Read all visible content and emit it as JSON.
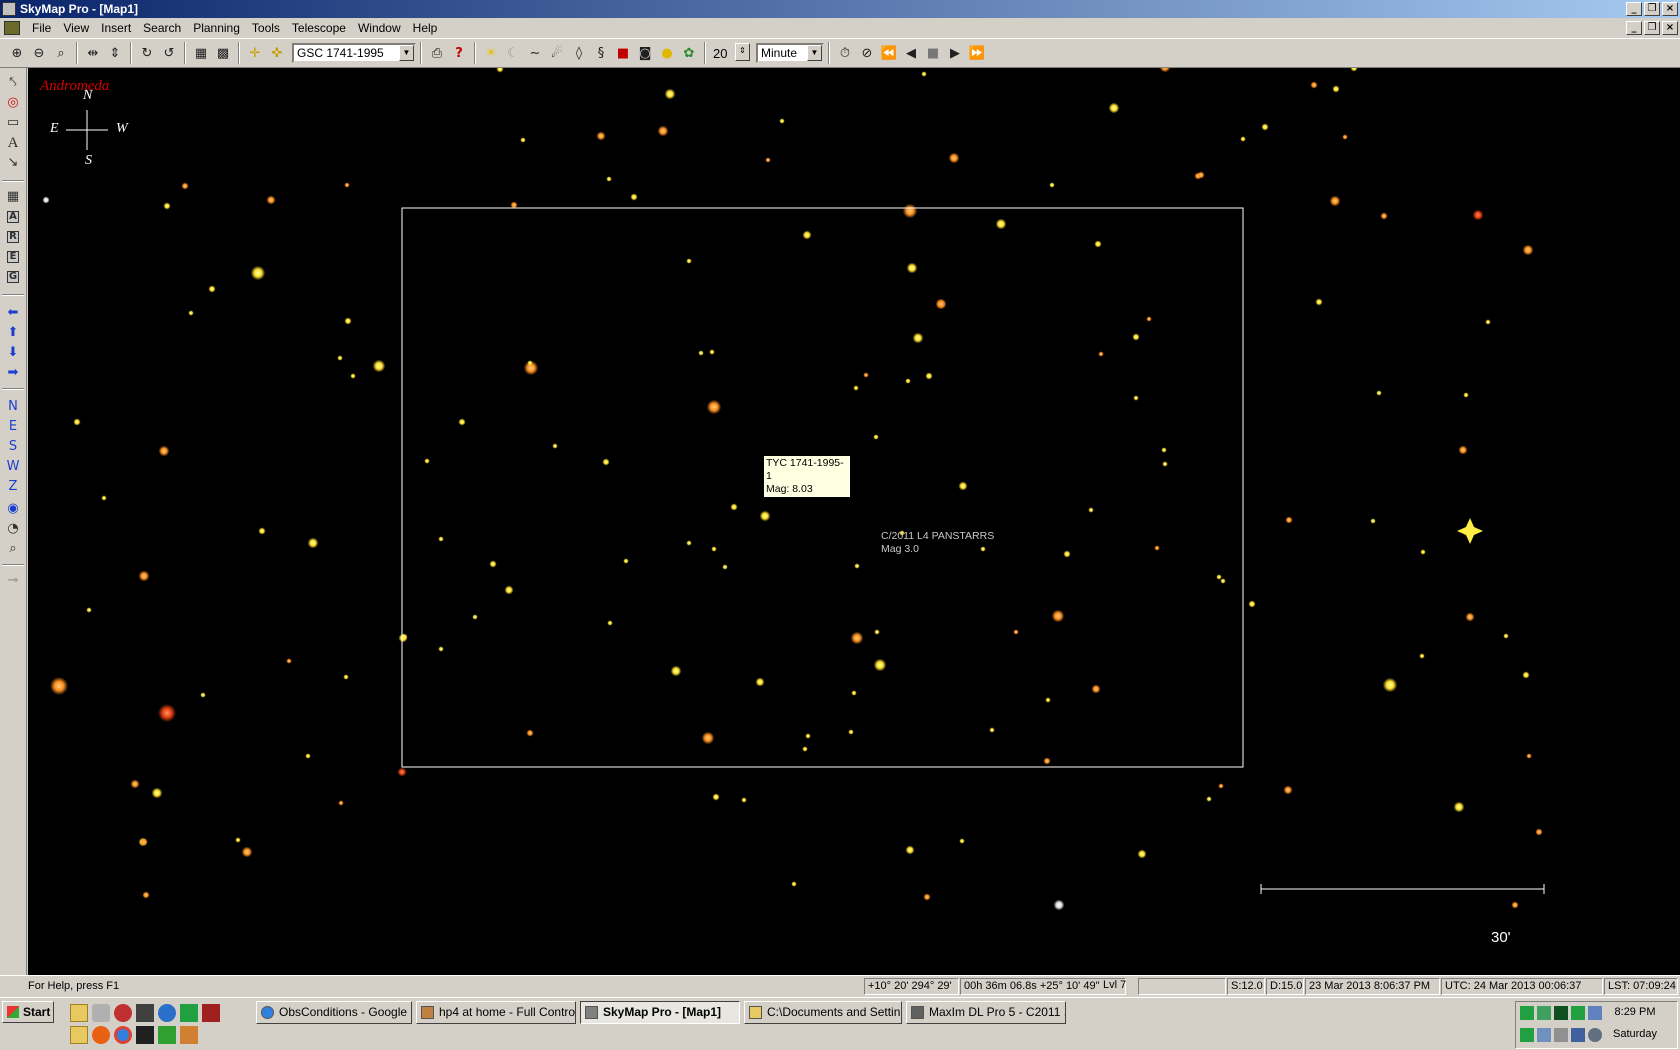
{
  "window": {
    "title": "SkyMap Pro - [Map1]"
  },
  "menu": [
    "File",
    "View",
    "Insert",
    "Search",
    "Planning",
    "Tools",
    "Telescope",
    "Window",
    "Help"
  ],
  "toolbar": {
    "catalog_value": "GSC 1741-1995",
    "step_value": "20",
    "unit_value": "Minute"
  },
  "leftbar": {
    "direction_letters": [
      "N",
      "E",
      "S",
      "W",
      "Z"
    ],
    "grid_letters": [
      "A",
      "R",
      "E",
      "G"
    ]
  },
  "map": {
    "constellation": "Andromeda",
    "compass": {
      "n": "N",
      "e": "E",
      "w": "W",
      "s": "S"
    },
    "tooltip": {
      "name": "TYC 1741-1995-1",
      "mag": "Mag: 8.03"
    },
    "comet": {
      "name": "C/2011 L4 PANSTARRS",
      "mag": "Mag 3.0"
    },
    "scale_label": "30'"
  },
  "statusbar": {
    "help": "For Help, press F1",
    "altaz": "+10° 20'  294° 29'",
    "radec": "00h 36m 06.8s  +25° 10' 49\"",
    "level": "Lvl 7",
    "blank": "",
    "size": "S:12.0",
    "depth": "D:15.0",
    "local_time": "23 Mar 2013 8:06:37 PM",
    "utc": "UTC: 24 Mar 2013 00:06:37",
    "lst": "LST: 07:09:24"
  },
  "taskbar": {
    "start": "Start",
    "tasks": [
      "ObsConditions - Google ...",
      "hp4 at home - Full Control",
      "SkyMap Pro - [Map1]",
      "C:\\Documents and Settin...",
      "MaxIm DL Pro 5 - C2011 ..."
    ],
    "clock": "8:29 PM",
    "day": "Saturday"
  },
  "colors": {
    "sky": "#000000",
    "constellation": "#d40000",
    "star_yellow": "#ffee44",
    "star_orange": "#ff9922",
    "star_red": "#ee4411"
  }
}
